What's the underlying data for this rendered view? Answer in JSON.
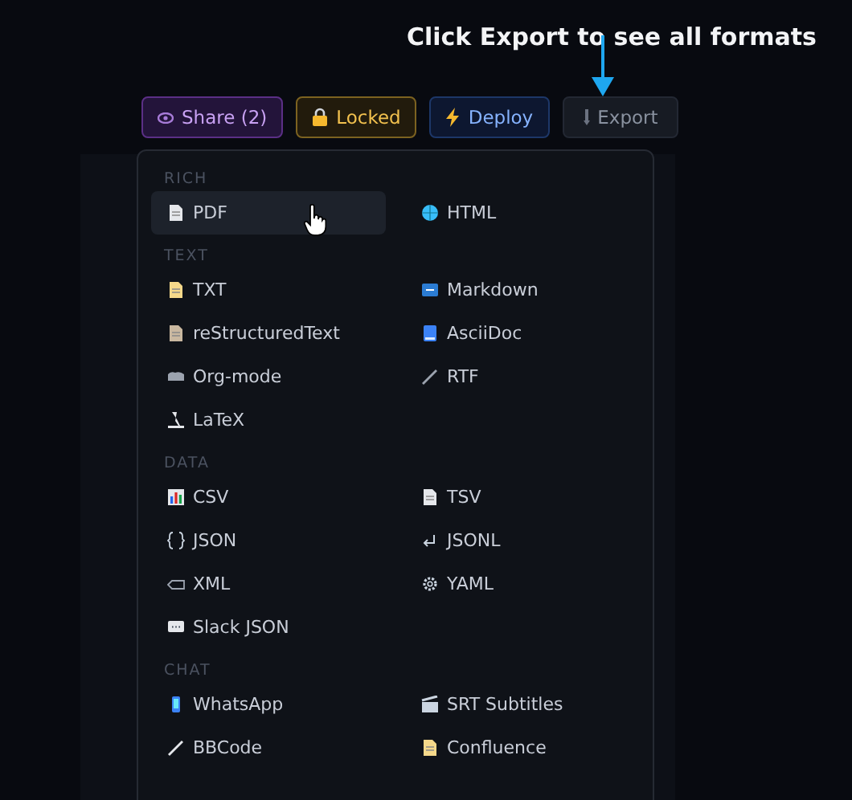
{
  "annotation": {
    "text": "Click Export to see all formats"
  },
  "toolbar": {
    "buttons": [
      {
        "label": "Share (2)",
        "kind": "share"
      },
      {
        "label": "Locked",
        "kind": "locked"
      },
      {
        "label": "Deploy",
        "kind": "deploy"
      },
      {
        "label": "Export",
        "kind": "export"
      }
    ]
  },
  "export_menu": {
    "sections": [
      {
        "title": "RICH",
        "items": [
          {
            "label": "PDF",
            "selected": true
          },
          {
            "label": "HTML",
            "selected": false
          }
        ]
      },
      {
        "title": "TEXT",
        "items": [
          {
            "label": "TXT",
            "selected": false
          },
          {
            "label": "Markdown",
            "selected": false
          },
          {
            "label": "reStructuredText",
            "selected": false
          },
          {
            "label": "AsciiDoc",
            "selected": false
          },
          {
            "label": "Org-mode",
            "selected": false
          },
          {
            "label": "RTF",
            "selected": false
          },
          {
            "label": "LaTeX",
            "selected": false
          }
        ]
      },
      {
        "title": "DATA",
        "items": [
          {
            "label": "CSV",
            "selected": false
          },
          {
            "label": "TSV",
            "selected": false
          },
          {
            "label": "JSON",
            "selected": false
          },
          {
            "label": "JSONL",
            "selected": false
          },
          {
            "label": "XML",
            "selected": false
          },
          {
            "label": "YAML",
            "selected": false
          },
          {
            "label": "Slack JSON",
            "selected": false
          }
        ]
      },
      {
        "title": "CHAT",
        "items": [
          {
            "label": "WhatsApp",
            "selected": false
          },
          {
            "label": "SRT Subtitles",
            "selected": false
          },
          {
            "label": "BBCode",
            "selected": false
          },
          {
            "label": "Confluence",
            "selected": false
          }
        ]
      }
    ]
  }
}
